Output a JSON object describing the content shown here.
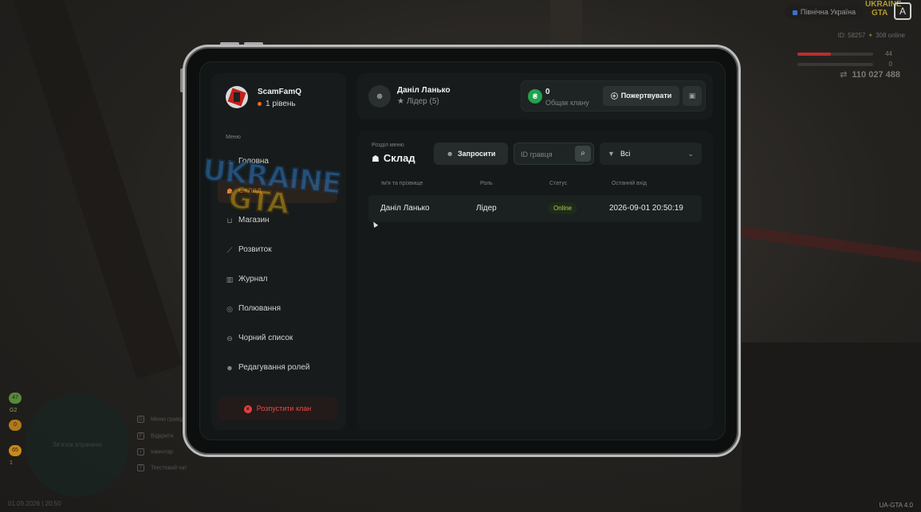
{
  "hud": {
    "region": "Північна Україна",
    "logo_top": "UKRAINE",
    "logo_bottom": "GTA",
    "id_text": "ID: 58257",
    "online_text": "308 online",
    "health_value": "44",
    "armor_value": "0",
    "money": "110 027 488",
    "date_time": "01.09.2026 | 20:50",
    "version": "UA-GTA 4.0",
    "minimap_text": "Зв'язок втрачено",
    "stats": [
      "47",
      "G2",
      "0",
      "65",
      "1"
    ],
    "hints": [
      "Меню гравця",
      "Відкрити",
      "Інвентар",
      "Текстовий чат"
    ],
    "hint_keys": [
      "O",
      "F",
      "I",
      "T"
    ]
  },
  "clan": {
    "name": "ScamFamQ",
    "level": "1 рівень"
  },
  "menu": {
    "heading": "Меню",
    "items": [
      {
        "label": "Головна",
        "icon": "home-icon",
        "glyph": "⌂"
      },
      {
        "label": "Склад",
        "icon": "people-icon",
        "glyph": "☗"
      },
      {
        "label": "Магазин",
        "icon": "basket-icon",
        "glyph": "⊔"
      },
      {
        "label": "Розвиток",
        "icon": "chart-icon",
        "glyph": "⟋"
      },
      {
        "label": "Журнал",
        "icon": "book-icon",
        "glyph": "▥"
      },
      {
        "label": "Полювання",
        "icon": "target-icon",
        "glyph": "◎"
      },
      {
        "label": "Чорний список",
        "icon": "block-icon",
        "glyph": "⊖"
      },
      {
        "label": "Редагування ролей",
        "icon": "user-edit-icon",
        "glyph": "☻"
      }
    ],
    "active_index": 1,
    "disband_label": "Розпустити клан"
  },
  "user": {
    "name": "Даніл Ланько",
    "role": "Лідер (5)"
  },
  "bank": {
    "value": "0",
    "label": "Общак клану",
    "donate_label": "Пожертвувати"
  },
  "section": {
    "label": "Розділ меню",
    "title": "Склад",
    "invite_label": "Запросити",
    "search_placeholder": "ID гравця",
    "filter_value": "Всі"
  },
  "table": {
    "headers": [
      "Ім'я та прізвище",
      "Роль",
      "Статус",
      "Останній вхід"
    ],
    "rows": [
      {
        "name": "Даніл Ланько",
        "role": "Лідер",
        "status": "Online",
        "last_login": "2026-09-01 20:50:19"
      }
    ]
  },
  "watermark": {
    "top": "UKRAINE",
    "bottom": "GTA"
  },
  "colors": {
    "accent": "#f07a2c",
    "danger": "#ec4b49",
    "online": "#9ed45a",
    "bank": "#21a34c"
  }
}
